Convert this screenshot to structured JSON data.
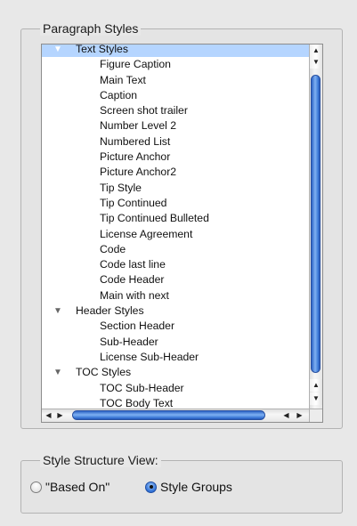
{
  "paragraph_styles": {
    "title": "Paragraph Styles",
    "rows": [
      {
        "label": "Text Styles",
        "kind": "group",
        "expanded": true,
        "selected": true
      },
      {
        "label": "Figure Caption",
        "kind": "child"
      },
      {
        "label": "Main Text",
        "kind": "child"
      },
      {
        "label": "Caption",
        "kind": "child"
      },
      {
        "label": "Screen shot trailer",
        "kind": "child"
      },
      {
        "label": "Number Level 2",
        "kind": "child"
      },
      {
        "label": "Numbered List",
        "kind": "child"
      },
      {
        "label": "Picture Anchor",
        "kind": "child"
      },
      {
        "label": "Picture Anchor2",
        "kind": "child"
      },
      {
        "label": "Tip Style",
        "kind": "child"
      },
      {
        "label": "Tip Continued",
        "kind": "child"
      },
      {
        "label": "Tip Continued Bulleted",
        "kind": "child"
      },
      {
        "label": "License Agreement",
        "kind": "child"
      },
      {
        "label": "Code",
        "kind": "child"
      },
      {
        "label": "Code last line",
        "kind": "child"
      },
      {
        "label": "Code Header",
        "kind": "child"
      },
      {
        "label": "Main with next",
        "kind": "child"
      },
      {
        "label": "Header Styles",
        "kind": "group",
        "expanded": true
      },
      {
        "label": "Section Header",
        "kind": "child"
      },
      {
        "label": "Sub-Header",
        "kind": "child"
      },
      {
        "label": "License Sub-Header",
        "kind": "child"
      },
      {
        "label": "TOC Styles",
        "kind": "group",
        "expanded": true
      },
      {
        "label": "TOC Sub-Header",
        "kind": "child"
      },
      {
        "label": "TOC Body Text",
        "kind": "child"
      }
    ]
  },
  "style_structure": {
    "title": "Style Structure View:",
    "options": [
      {
        "label": "\"Based On\"",
        "checked": false
      },
      {
        "label": "Style Groups",
        "checked": true
      }
    ]
  },
  "icons": {
    "expanded_triangle": "▼",
    "scroll_up": "▲",
    "scroll_down": "▼",
    "scroll_left": "◀",
    "scroll_right": "▶"
  },
  "colors": {
    "selection": "#b5d5ff",
    "scroll_thumb": "#3e7bd8"
  }
}
